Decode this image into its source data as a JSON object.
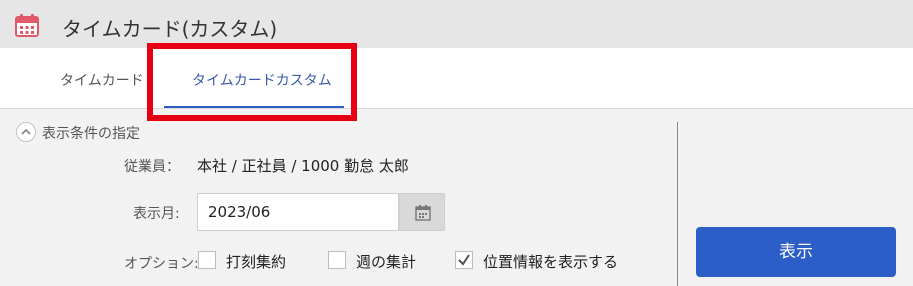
{
  "window": {
    "title": "タイムカード(カスタム)"
  },
  "tabs": [
    {
      "label": "タイムカード"
    },
    {
      "label": "タイムカードカスタム"
    }
  ],
  "section": {
    "title": "表示条件の指定"
  },
  "employee": {
    "label": "従業員：",
    "value": "本社 / 正社員 / 1000 勤怠 太郎"
  },
  "month": {
    "label": "表示月:",
    "value": "2023/06"
  },
  "options": {
    "label": "オプション:",
    "items": [
      {
        "label": "打刻集約",
        "checked": false
      },
      {
        "label": "週の集計",
        "checked": false
      },
      {
        "label": "位置情報を表示する",
        "checked": true
      }
    ]
  },
  "actions": {
    "show_label": "表示"
  },
  "colors": {
    "accent": "#2c5ec8",
    "highlight": "#e60012",
    "icon_red": "#e05a6a"
  },
  "icons": [
    "calendar-icon",
    "chevron-up-icon",
    "check-icon"
  ]
}
